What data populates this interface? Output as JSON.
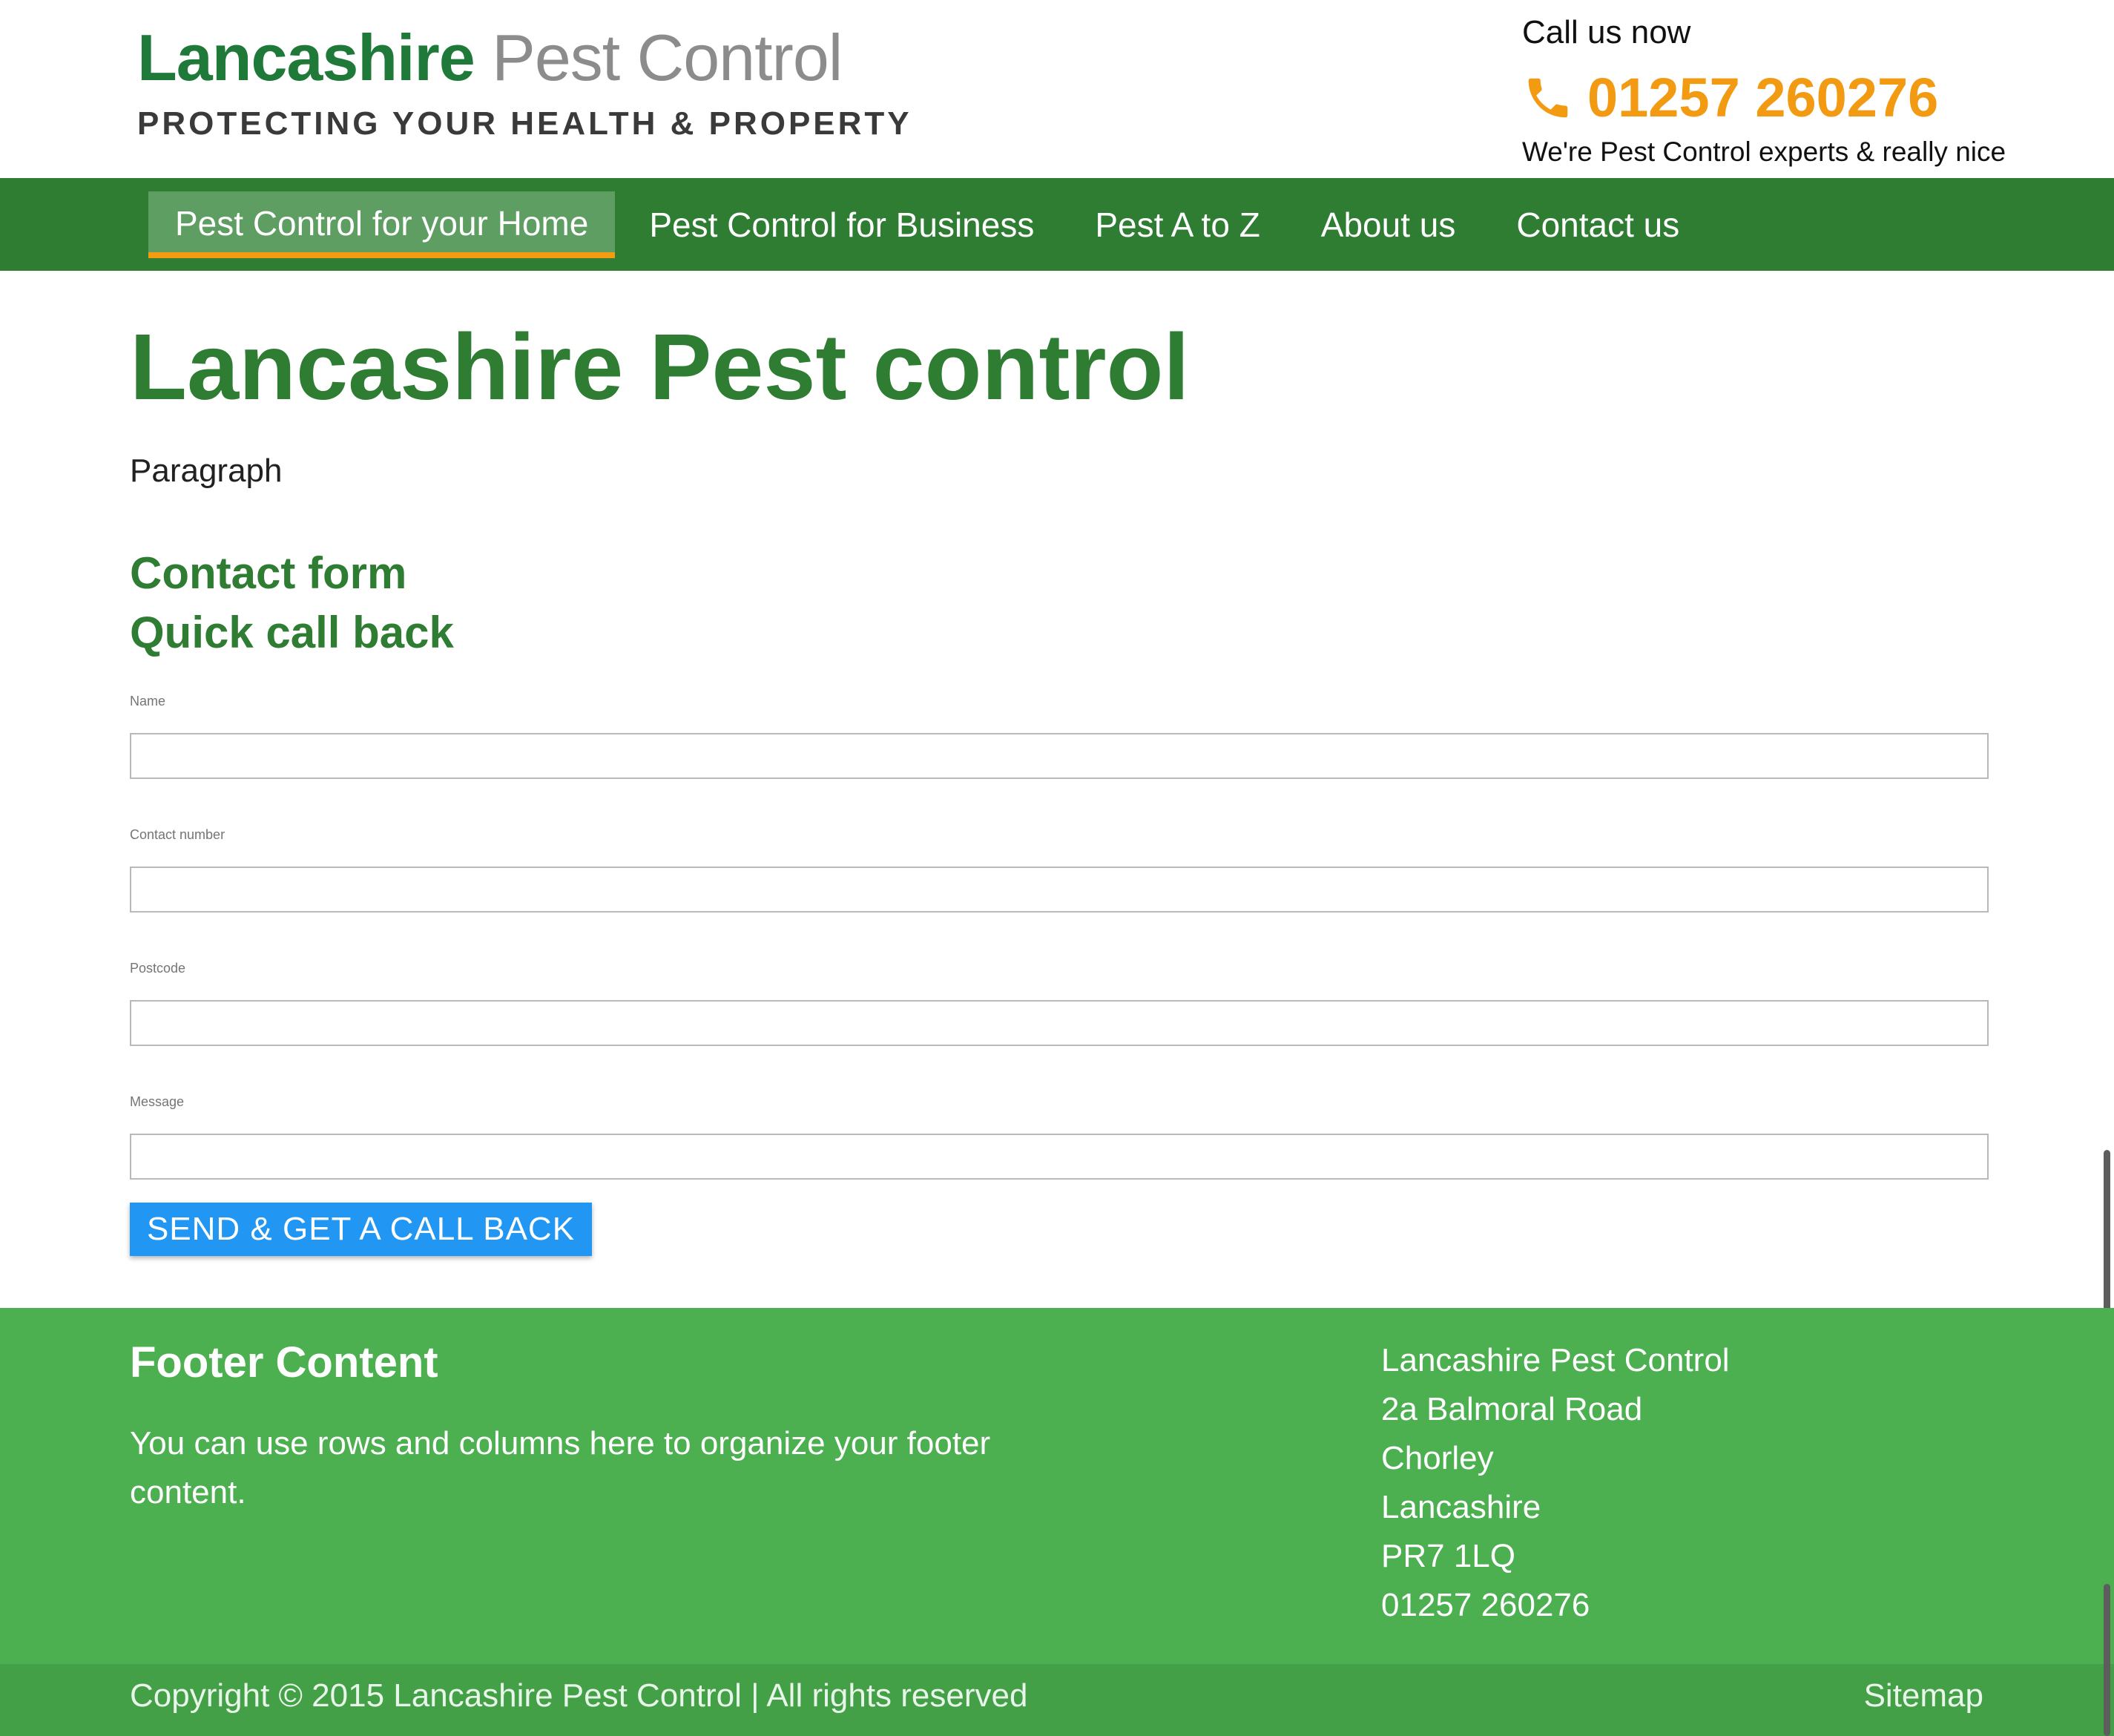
{
  "header": {
    "logo_brand": "Lancashire",
    "logo_sub": "Pest Control",
    "logo_tagline": "PROTECTING YOUR HEALTH & PROPERTY",
    "call_label": "Call us now",
    "phone": "01257 260276",
    "call_tagline": "We're Pest Control experts & really nice",
    "phone_icon": "phone-icon",
    "accent_color": "#f29a12"
  },
  "nav": {
    "items": [
      {
        "label": "Pest Control for your Home",
        "active": true
      },
      {
        "label": "Pest Control for Business"
      },
      {
        "label": "Pest A to Z"
      },
      {
        "label": "About us"
      },
      {
        "label": "Contact us"
      }
    ],
    "background": "#2e7d32"
  },
  "main": {
    "title": "Lancashire Pest control",
    "paragraph": "Paragraph",
    "contact_heading": "Contact form",
    "callback_heading": "Quick call back",
    "title_color": "#2e7d32"
  },
  "form": {
    "fields": [
      {
        "label": "Name",
        "value": ""
      },
      {
        "label": "Contact number",
        "value": ""
      },
      {
        "label": "Postcode",
        "value": ""
      },
      {
        "label": "Message",
        "value": ""
      }
    ],
    "submit_label": "SEND & GET A CALL BACK",
    "submit_color": "#2196f3"
  },
  "footer": {
    "title": "Footer Content",
    "text": "You can use rows and columns here to organize your footer content.",
    "address": [
      "Lancashire Pest Control",
      "2a Balmoral Road",
      "Chorley",
      "Lancashire",
      "PR7 1LQ",
      "01257 260276"
    ],
    "copyright": "Copyright © 2015 Lancashire Pest Control | All rights reserved",
    "sitemap": "Sitemap",
    "background": "#4caf50"
  }
}
